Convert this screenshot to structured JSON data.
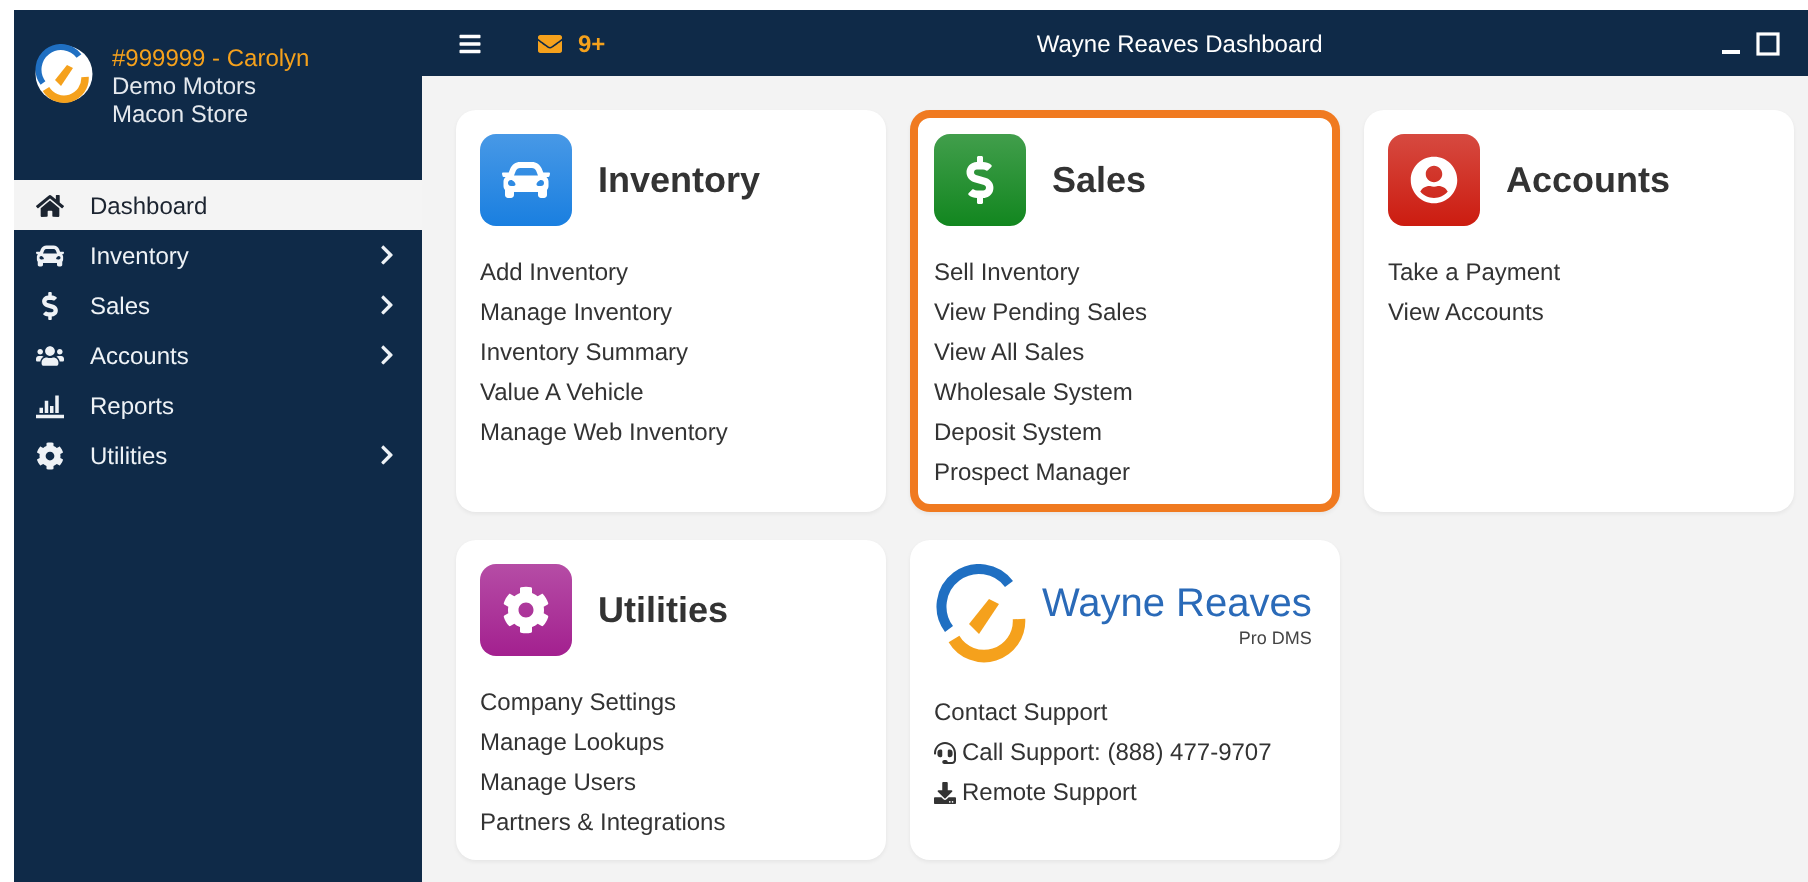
{
  "user": {
    "account": "#999999 - Carolyn",
    "dealer": "Demo Motors",
    "store": "Macon Store"
  },
  "sidebar": {
    "items": [
      {
        "label": "Dashboard",
        "selected": true,
        "has_submenu": false
      },
      {
        "label": "Inventory",
        "selected": false,
        "has_submenu": true
      },
      {
        "label": "Sales",
        "selected": false,
        "has_submenu": true
      },
      {
        "label": "Accounts",
        "selected": false,
        "has_submenu": true
      },
      {
        "label": "Reports",
        "selected": false,
        "has_submenu": false
      },
      {
        "label": "Utilities",
        "selected": false,
        "has_submenu": true
      }
    ]
  },
  "topbar": {
    "mail_count": "9+",
    "title": "Wayne Reaves Dashboard"
  },
  "cards": [
    {
      "kind": "module",
      "title": "Inventory",
      "color": "#1a7fe0",
      "highlighted": false,
      "links": [
        "Add Inventory",
        "Manage Inventory",
        "Inventory Summary",
        "Value A Vehicle",
        "Manage Web Inventory"
      ]
    },
    {
      "kind": "module",
      "title": "Sales",
      "color": "#12861f",
      "highlighted": true,
      "links": [
        "Sell Inventory",
        "View Pending Sales",
        "View All Sales",
        "Wholesale System",
        "Deposit System",
        "Prospect Manager"
      ]
    },
    {
      "kind": "module",
      "title": "Accounts",
      "color": "#cc1c10",
      "highlighted": false,
      "links": [
        "Take a Payment",
        "View Accounts"
      ]
    },
    {
      "kind": "module",
      "title": "Utilities",
      "color": "#a3208f",
      "highlighted": false,
      "links": [
        "Company Settings",
        "Manage Lookups",
        "Manage Users",
        "Partners & Integrations"
      ]
    },
    {
      "kind": "support",
      "brand": "Wayne Reaves",
      "subbrand": "Pro DMS",
      "highlighted": false,
      "links": [
        {
          "kind": "plain",
          "label": "Contact Support"
        },
        {
          "kind": "phone",
          "label": "Call Support: (888) 477-9707"
        },
        {
          "kind": "download",
          "label": "Remote Support"
        }
      ]
    }
  ]
}
